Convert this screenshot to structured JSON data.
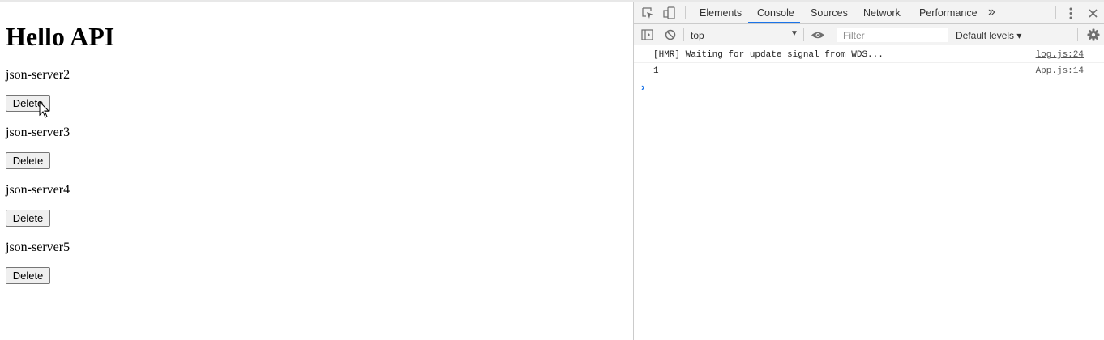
{
  "page": {
    "heading": "Hello API",
    "items": [
      {
        "name": "json-server2",
        "button": "Delete"
      },
      {
        "name": "json-server3",
        "button": "Delete"
      },
      {
        "name": "json-server4",
        "button": "Delete"
      },
      {
        "name": "json-server5",
        "button": "Delete"
      }
    ]
  },
  "devtools": {
    "tabs": [
      "Elements",
      "Console",
      "Sources",
      "Network",
      "Performance"
    ],
    "active_tab": "Console",
    "more_tabs": "»",
    "context": "top",
    "filter_placeholder": "Filter",
    "levels": "Default levels ▾",
    "messages": [
      {
        "text": "[HMR] Waiting for update signal from WDS...",
        "source": "log.js:24"
      },
      {
        "text": "1",
        "source": "App.js:14"
      }
    ],
    "prompt": "›"
  },
  "icons": {
    "inspect": "inspect-element-icon",
    "device": "device-toolbar-icon",
    "menu": "kebab-menu-icon",
    "close": "close-icon",
    "sidebar": "show-sidebar-icon",
    "clear": "clear-console-icon",
    "eye": "live-expression-icon",
    "settings": "gear-icon"
  },
  "colors": {
    "accent": "#1a73e8"
  }
}
